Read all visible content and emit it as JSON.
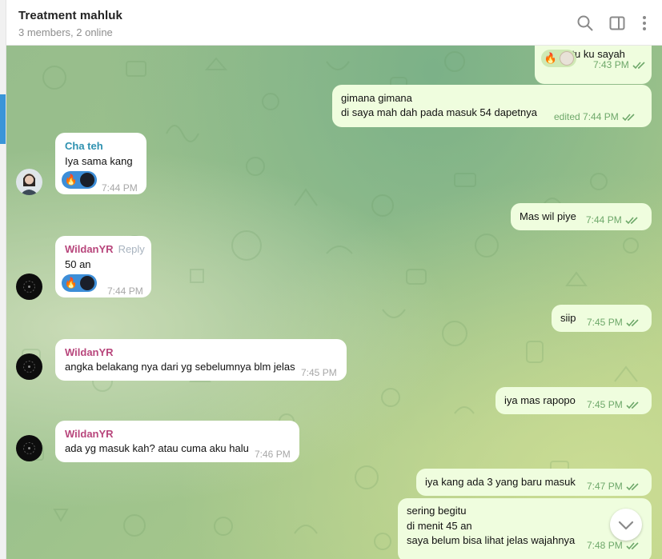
{
  "header": {
    "title": "Treatment mahluk",
    "subtitle": "3 members, 2 online",
    "icons": [
      "search-icon",
      "sidebar-toggle-icon",
      "more-vertical-icon"
    ]
  },
  "colors": {
    "outgoing_bubble": "#effdde",
    "incoming_bubble": "#ffffff",
    "check_color": "#6ea86a",
    "accent": "#3a95d8",
    "sender_chateh": "#2e91b0",
    "sender_wildan": "#b8467c"
  },
  "messages": [
    {
      "dir": "out",
      "text": "di bantu ku sayah",
      "time": "7:43 PM",
      "reactions": [
        "🔥"
      ]
    },
    {
      "dir": "out",
      "line1": "gimana gimana",
      "line2": "di saya mah dah pada masuk  54 dapetnya",
      "edited": "edited",
      "time": "7:44 PM"
    },
    {
      "dir": "in",
      "sender": "Cha teh",
      "text": "Iya sama kang",
      "time": "7:44 PM",
      "reactions": [
        "🔥"
      ]
    },
    {
      "dir": "out",
      "text": "Mas wil piye",
      "time": "7:44 PM"
    },
    {
      "dir": "in",
      "sender": "WildanYR",
      "reply": "Reply",
      "text": "50 an",
      "time": "7:44 PM",
      "reactions": [
        "🔥"
      ]
    },
    {
      "dir": "out",
      "text": "siip",
      "time": "7:45 PM"
    },
    {
      "dir": "in",
      "sender": "WildanYR",
      "text": "angka belakang nya dari yg sebelumnya blm jelas",
      "time": "7:45 PM"
    },
    {
      "dir": "out",
      "text": "iya mas rapopo",
      "time": "7:45 PM"
    },
    {
      "dir": "in",
      "sender": "WildanYR",
      "text": "ada yg masuk kah? atau cuma aku halu",
      "time": "7:46 PM"
    },
    {
      "dir": "out",
      "text": "iya kang ada 3 yang baru masuk",
      "time": "7:47 PM"
    },
    {
      "dir": "out",
      "line1": "sering begitu",
      "line2": "di menit 45 an",
      "line3": "saya belum bisa lihat jelas wajahnya",
      "time": "7:48 PM"
    }
  ]
}
